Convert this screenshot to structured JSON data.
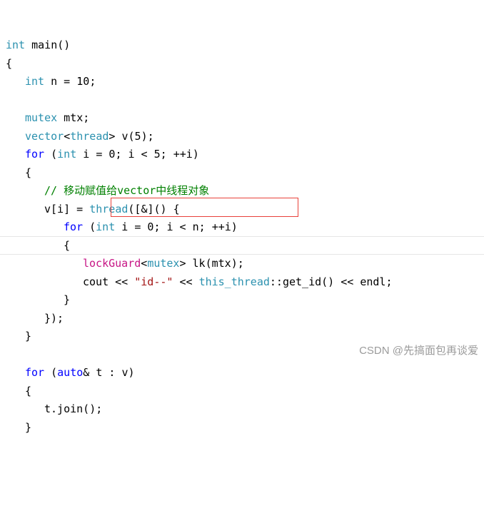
{
  "code": {
    "language": "cpp",
    "lines": [
      {
        "indent": 0,
        "tokens": [
          {
            "t": "int",
            "c": "type"
          },
          {
            "t": " main",
            "c": "plain"
          },
          {
            "t": "()",
            "c": "plain"
          }
        ]
      },
      {
        "indent": 0,
        "tokens": [
          {
            "t": "{",
            "c": "plain"
          }
        ]
      },
      {
        "indent": 1,
        "tokens": [
          {
            "t": "int",
            "c": "type"
          },
          {
            "t": " n = ",
            "c": "plain"
          },
          {
            "t": "10",
            "c": "num"
          },
          {
            "t": ";",
            "c": "plain"
          }
        ]
      },
      {
        "indent": 0,
        "tokens": []
      },
      {
        "indent": 1,
        "tokens": [
          {
            "t": "mutex",
            "c": "cls"
          },
          {
            "t": " mtx;",
            "c": "plain"
          }
        ]
      },
      {
        "indent": 1,
        "tokens": [
          {
            "t": "vector",
            "c": "cls"
          },
          {
            "t": "<",
            "c": "plain"
          },
          {
            "t": "thread",
            "c": "cls"
          },
          {
            "t": "> v(",
            "c": "plain"
          },
          {
            "t": "5",
            "c": "num"
          },
          {
            "t": ");",
            "c": "plain"
          }
        ]
      },
      {
        "indent": 1,
        "tokens": [
          {
            "t": "for",
            "c": "kw"
          },
          {
            "t": " (",
            "c": "plain"
          },
          {
            "t": "int",
            "c": "type"
          },
          {
            "t": " i = ",
            "c": "plain"
          },
          {
            "t": "0",
            "c": "num"
          },
          {
            "t": "; i < ",
            "c": "plain"
          },
          {
            "t": "5",
            "c": "num"
          },
          {
            "t": "; ++i)",
            "c": "plain"
          }
        ]
      },
      {
        "indent": 1,
        "tokens": [
          {
            "t": "{",
            "c": "plain"
          }
        ]
      },
      {
        "indent": 2,
        "tokens": [
          {
            "t": "// 移动赋值给vector中线程对象",
            "c": "cmt"
          }
        ]
      },
      {
        "indent": 2,
        "tokens": [
          {
            "t": "v[i] = ",
            "c": "plain"
          },
          {
            "t": "thread",
            "c": "cls"
          },
          {
            "t": "([&]() {",
            "c": "plain"
          }
        ]
      },
      {
        "indent": 3,
        "tokens": [
          {
            "t": "for",
            "c": "kw"
          },
          {
            "t": " (",
            "c": "plain"
          },
          {
            "t": "int",
            "c": "type"
          },
          {
            "t": " i = ",
            "c": "plain"
          },
          {
            "t": "0",
            "c": "num"
          },
          {
            "t": "; i < n; ++i)",
            "c": "plain"
          }
        ]
      },
      {
        "indent": 3,
        "tokens": [
          {
            "t": "{",
            "c": "plain"
          }
        ]
      },
      {
        "indent": 4,
        "tokens": [
          {
            "t": "lockGuard",
            "c": "pink"
          },
          {
            "t": "<",
            "c": "plain"
          },
          {
            "t": "mutex",
            "c": "cls"
          },
          {
            "t": "> lk(mtx);",
            "c": "plain"
          }
        ]
      },
      {
        "indent": 4,
        "tokens": [
          {
            "t": "cout << ",
            "c": "plain"
          },
          {
            "t": "\"id--\"",
            "c": "str"
          },
          {
            "t": " << ",
            "c": "plain"
          },
          {
            "t": "this_thread",
            "c": "cls"
          },
          {
            "t": "::get_id() << endl;",
            "c": "plain"
          }
        ]
      },
      {
        "indent": 3,
        "tokens": [
          {
            "t": "}",
            "c": "plain"
          }
        ]
      },
      {
        "indent": 2,
        "tokens": [
          {
            "t": "});",
            "c": "plain"
          }
        ]
      },
      {
        "indent": 1,
        "tokens": [
          {
            "t": "}",
            "c": "plain"
          }
        ]
      },
      {
        "indent": 0,
        "tokens": []
      },
      {
        "indent": 1,
        "tokens": [
          {
            "t": "for",
            "c": "kw"
          },
          {
            "t": " (",
            "c": "plain"
          },
          {
            "t": "auto",
            "c": "kw"
          },
          {
            "t": "& t : v)",
            "c": "plain"
          }
        ]
      },
      {
        "indent": 1,
        "tokens": [
          {
            "t": "{",
            "c": "plain"
          }
        ]
      },
      {
        "indent": 2,
        "tokens": [
          {
            "t": "t.join();",
            "c": "plain"
          }
        ]
      },
      {
        "indent": 1,
        "tokens": [
          {
            "t": "}",
            "c": "plain"
          }
        ]
      }
    ]
  },
  "highlight": {
    "color": "#e8413a",
    "target_text": "lockGuard<mutex> lk(mtx);"
  },
  "watermark": {
    "text": "CSDN @先搞面包再谈爱",
    "color": "#9b9b9b"
  }
}
